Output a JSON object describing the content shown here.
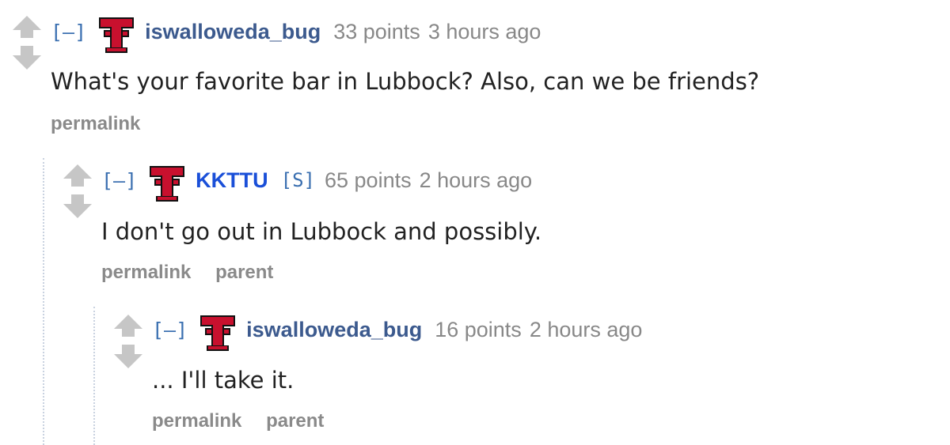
{
  "comments": [
    {
      "expand": "[–]",
      "author": "iswalloweda_bug",
      "score": "33 points",
      "time": "3 hours ago",
      "body": "What's your favorite bar in Lubbock? Also, can we be friends?",
      "actions": [
        "permalink"
      ],
      "flair_icon": "texas-tech-double-t-icon"
    },
    {
      "expand": "[–]",
      "author": "KKTTU",
      "submitter_tag": "[S]",
      "score": "65 points",
      "time": "2 hours ago",
      "body": "I don't go out in Lubbock and possibly.",
      "actions": [
        "permalink",
        "parent"
      ],
      "flair_icon": "texas-tech-double-t-icon"
    },
    {
      "expand": "[–]",
      "author": "iswalloweda_bug",
      "score": "16 points",
      "time": "2 hours ago",
      "body": "... I'll take it.",
      "actions": [
        "permalink",
        "parent"
      ],
      "flair_icon": "texas-tech-double-t-icon"
    }
  ],
  "colors": {
    "author": "#3c5a8e",
    "submitter": "#1a4fd8",
    "meta": "#888888",
    "flair_red": "#c8102e"
  }
}
